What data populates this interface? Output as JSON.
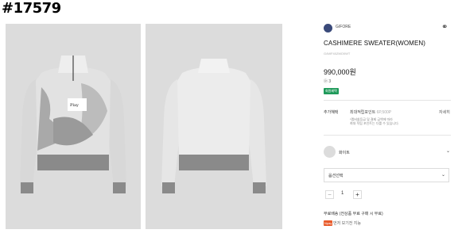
{
  "page": {
    "product_id_label": "#17579"
  },
  "gallery": {
    "front_alt": "front",
    "back_alt": "back"
  },
  "brand": {
    "name": "G/FORE"
  },
  "product": {
    "title": "CASHIMERE SWEATER(WOMEN)",
    "subtitle": "G4WF40ZMO0WT",
    "price": "990,000원",
    "points": "ⓟ 3",
    "badge": "회원혜택"
  },
  "benefit": {
    "label": "추가혜택",
    "value_prefix": "최대적립포인트",
    "value_points": "6P,500P",
    "detail_link": "자세히",
    "note_line1": "*멤버쉽등급 및 결제 금액에 따라",
    "note_line2": "최대 적립 포인트는 다를 수 있습니다."
  },
  "color": {
    "label": "화이트"
  },
  "option": {
    "placeholder": "옵션선택"
  },
  "quantity": {
    "minus": "−",
    "value": "1",
    "plus": "+"
  },
  "shipping": {
    "text": "무료배송 (전상품 무료 구매 시 무료)",
    "icon_label": "Npay",
    "extra": "먼저 보기전 지능"
  },
  "colors": {
    "accent_green": "#1f9a5a",
    "brand_circle": "#3a4a7a",
    "photo_bg": "#dcdcdc"
  }
}
